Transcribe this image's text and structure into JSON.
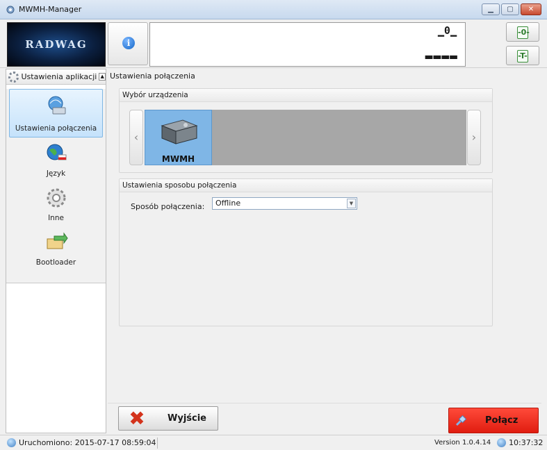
{
  "window": {
    "title": "MWMH-Manager"
  },
  "header": {
    "logo_text": "RADWAG",
    "display": {
      "zero_symbol": "̄0̄",
      "reading": "▬▬▬▬"
    },
    "zero_button_icon": "zero-icon",
    "tare_button_icon": "tare-icon"
  },
  "sidebar": {
    "header_label": "Ustawienia aplikacji",
    "items": [
      {
        "label": "Ustawienia połączenia",
        "icon": "network-settings-icon",
        "active": true
      },
      {
        "label": "Język",
        "icon": "language-globe-icon",
        "active": false
      },
      {
        "label": "Inne",
        "icon": "gear-icon",
        "active": false
      },
      {
        "label": "Bootloader",
        "icon": "bootloader-icon",
        "active": false
      }
    ]
  },
  "content": {
    "title": "Ustawienia połączenia",
    "device_group": {
      "title": "Wybór urządzenia",
      "devices": [
        {
          "name": "MWMH",
          "selected": true
        }
      ]
    },
    "connection_group": {
      "title": "Ustawienia sposobu połączenia",
      "method_label": "Sposób połączenia:",
      "method_value": "Offline"
    }
  },
  "actions": {
    "exit_label": "Wyjście",
    "connect_label": "Połącz"
  },
  "status": {
    "started": "Uruchomiono: 2015-07-17 08:59:04",
    "version": "Version 1.0.4.14",
    "time": "10:37:32"
  },
  "colors": {
    "connect_button": "#e8281a",
    "selected_nav": "#c5e2fb",
    "device_card": "#7fb6e6"
  }
}
